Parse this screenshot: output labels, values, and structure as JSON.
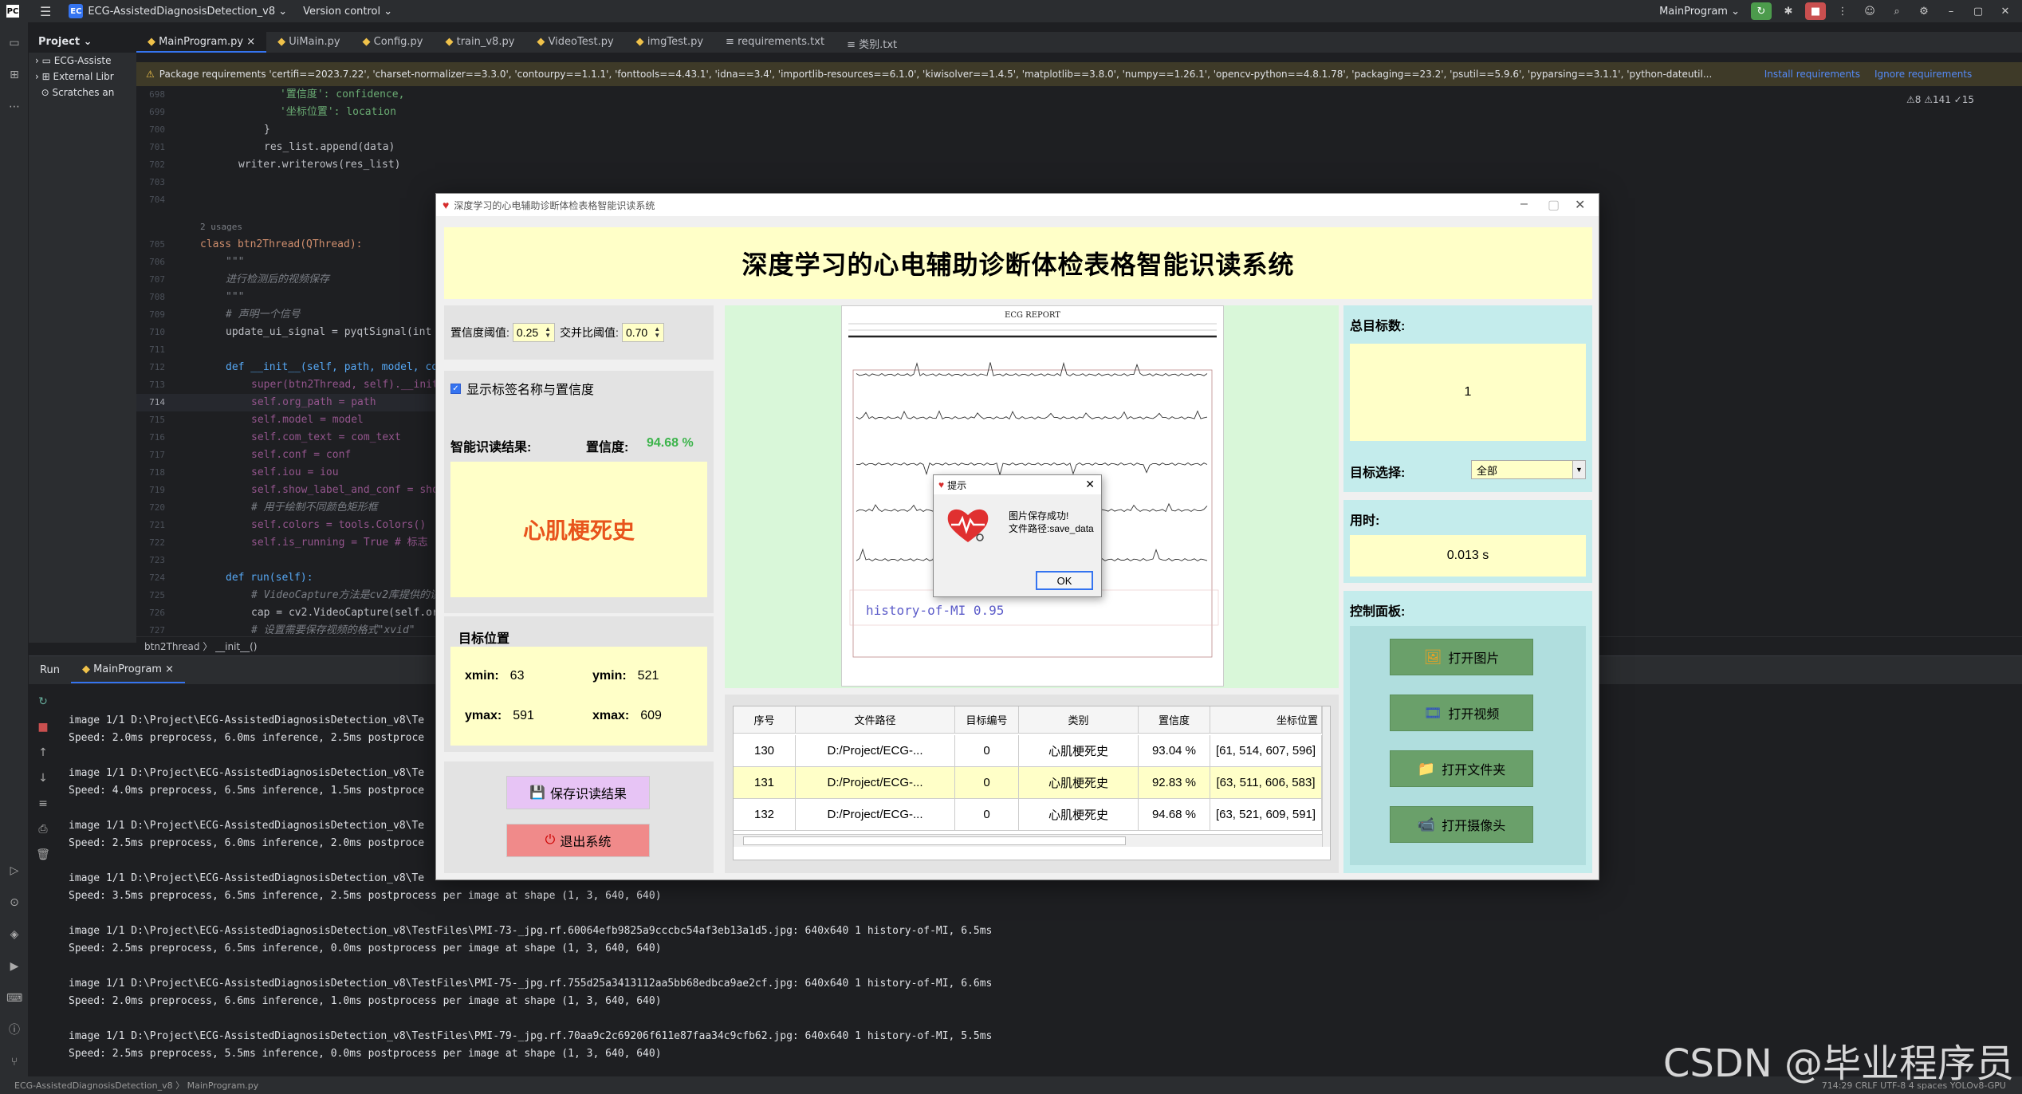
{
  "ide": {
    "badge": "EC",
    "project_name": "ECG-AssistedDiagnosisDetection_v8 ⌄",
    "version_control": "Version control ⌄",
    "run_config": "MainProgram ⌄",
    "project_header": "Project ⌄",
    "tabs": [
      {
        "label": "MainProgram.py ×"
      },
      {
        "label": "UiMain.py"
      },
      {
        "label": "Config.py"
      },
      {
        "label": "train_v8.py"
      },
      {
        "label": "VideoTest.py"
      },
      {
        "label": "imgTest.py"
      },
      {
        "label": "requirements.txt"
      },
      {
        "label": "类别.txt"
      }
    ],
    "tree": [
      "ECG-Assiste",
      "External Libr",
      "Scratches an"
    ],
    "warning": {
      "text": "Package requirements 'certifi==2023.7.22', 'charset-normalizer==3.3.0', 'contourpy==1.1.1', 'fonttools==4.43.1', 'idna==3.4', 'importlib-resources==6.1.0', 'kiwisolver==1.4.5', 'matplotlib==3.8.0', 'numpy==1.26.1', 'opencv-python==4.8.1.78', 'packaging==23.2', 'psutil==5.9.6', 'pyparsing==3.1.1', 'python-dateutil...",
      "install": "Install requirements",
      "ignore": "Ignore requirements"
    },
    "inspection": "⚠8 ⚠141 ✓15",
    "breadcrumb": "btn2Thread  〉 __init__()",
    "run_tab": "Run",
    "run_config_tab": "MainProgram ×",
    "status_left": "ECG-AssistedDiagnosisDetection_v8 〉 MainProgram.py",
    "status_right": "714:29   CRLF   UTF-8   4 spaces   YOLOv8-GPU"
  },
  "code": [
    {
      "ln": "698",
      "text": "'置信度': confidence,"
    },
    {
      "ln": "699",
      "text": "'坐标位置': location"
    },
    {
      "ln": "700",
      "text": "}"
    },
    {
      "ln": "701",
      "text": "res_list.append(data)"
    },
    {
      "ln": "702",
      "text": "writer.writerows(res_list)"
    },
    {
      "ln": "703",
      "text": ""
    },
    {
      "ln": "704",
      "text": ""
    },
    {
      "ln": "",
      "text": "2 usages"
    },
    {
      "ln": "705",
      "text": "class btn2Thread(QThread):"
    },
    {
      "ln": "706",
      "text": "\"\"\""
    },
    {
      "ln": "707",
      "text": "进行检测后的视频保存"
    },
    {
      "ln": "708",
      "text": "\"\"\""
    },
    {
      "ln": "709",
      "text": "# 声明一个信号"
    },
    {
      "ln": "710",
      "text": "update_ui_signal = pyqtSignal(int"
    },
    {
      "ln": "711",
      "text": ""
    },
    {
      "ln": "712",
      "text": "def __init__(self, path, model, co"
    },
    {
      "ln": "713",
      "text": "super(btn2Thread, self).__init"
    },
    {
      "ln": "714",
      "text": "self.org_path = path"
    },
    {
      "ln": "715",
      "text": "self.model = model"
    },
    {
      "ln": "716",
      "text": "self.com_text = com_text"
    },
    {
      "ln": "717",
      "text": "self.conf = conf"
    },
    {
      "ln": "718",
      "text": "self.iou = iou"
    },
    {
      "ln": "719",
      "text": "self.show_label_and_conf = sho"
    },
    {
      "ln": "720",
      "text": "# 用于绘制不同颜色矩形框"
    },
    {
      "ln": "721",
      "text": "self.colors = tools.Colors()"
    },
    {
      "ln": "722",
      "text": "self.is_running = True  # 标志"
    },
    {
      "ln": "723",
      "text": ""
    },
    {
      "ln": "724",
      "text": "def run(self):"
    },
    {
      "ln": "725",
      "text": "# VideoCapture方法是cv2库提供的读"
    },
    {
      "ln": "726",
      "text": "cap = cv2.VideoCapture(self.or"
    },
    {
      "ln": "727",
      "text": "# 设置需要保存视频的格式\"xvid\""
    }
  ],
  "console": [
    "image 1/1 D:\\Project\\ECG-AssistedDiagnosisDetection_v8\\Te",
    "Speed: 2.0ms preprocess, 6.0ms inference, 2.5ms postproce",
    "",
    "image 1/1 D:\\Project\\ECG-AssistedDiagnosisDetection_v8\\Te",
    "Speed: 4.0ms preprocess, 6.5ms inference, 1.5ms postproce",
    "",
    "image 1/1 D:\\Project\\ECG-AssistedDiagnosisDetection_v8\\Te",
    "Speed: 2.5ms preprocess, 6.0ms inference, 2.0ms postproce",
    "",
    "image 1/1 D:\\Project\\ECG-AssistedDiagnosisDetection_v8\\Te",
    "Speed: 3.5ms preprocess, 6.5ms inference, 2.5ms postprocess per image at shape (1, 3, 640, 640)",
    "",
    "image 1/1 D:\\Project\\ECG-AssistedDiagnosisDetection_v8\\TestFiles\\PMI-73-_jpg.rf.60064efb9825a9cccbc54af3eb13a1d5.jpg: 640x640 1 history-of-MI, 6.5ms",
    "Speed: 2.5ms preprocess, 6.5ms inference, 0.0ms postprocess per image at shape (1, 3, 640, 640)",
    "",
    "image 1/1 D:\\Project\\ECG-AssistedDiagnosisDetection_v8\\TestFiles\\PMI-75-_jpg.rf.755d25a3413112aa5bb68edbca9ae2cf.jpg: 640x640 1 history-of-MI, 6.6ms",
    "Speed: 2.0ms preprocess, 6.6ms inference, 1.0ms postprocess per image at shape (1, 3, 640, 640)",
    "",
    "image 1/1 D:\\Project\\ECG-AssistedDiagnosisDetection_v8\\TestFiles\\PMI-79-_jpg.rf.70aa9c2c69206f611e87faa34c9cfb62.jpg: 640x640 1 history-of-MI, 5.5ms",
    "Speed: 2.5ms preprocess, 5.5ms inference, 0.0ms postprocess per image at shape (1, 3, 640, 640)"
  ],
  "watermark": "CSDN @毕业程序员",
  "app": {
    "window_title": "深度学习的心电辅助诊断体检表格智能识读系统",
    "header_title": "深度学习的心电辅助诊断体检表格智能识读系统",
    "conf_threshold_label": "置信度阈值:",
    "conf_threshold": "0.25",
    "iou_threshold_label": "交并比阈值:",
    "iou_threshold": "0.70",
    "show_label_text": "显示标签名称与置信度",
    "result_label": "智能识读结果:",
    "confidence_label": "置信度:",
    "confidence_value": "94.68 %",
    "result_class": "心肌梗死史",
    "position_title": "目标位置",
    "xmin_label": "xmin:",
    "xmin": "63",
    "ymin_label": "ymin:",
    "ymin": "521",
    "ymax_label": "ymax:",
    "ymax": "591",
    "xmax_label": "xmax:",
    "xmax": "609",
    "save_btn": "保存识读结果",
    "exit_btn": "退出系统",
    "detection_label": "history-of-MI  0.95",
    "ecg_report_title": "ECG REPORT",
    "table": {
      "headers": [
        "序号",
        "文件路径",
        "目标编号",
        "类别",
        "置信度",
        "坐标位置"
      ],
      "rows": [
        [
          "130",
          "D:/Project/ECG-...",
          "0",
          "心肌梗死史",
          "93.04 %",
          "[61, 514, 607, 596]"
        ],
        [
          "131",
          "D:/Project/ECG-...",
          "0",
          "心肌梗死史",
          "92.83 %",
          "[63, 511, 606, 583]"
        ],
        [
          "132",
          "D:/Project/ECG-...",
          "0",
          "心肌梗死史",
          "94.68 %",
          "[63, 521, 609, 591]"
        ]
      ]
    },
    "total_label": "总目标数:",
    "total_value": "1",
    "target_select_label": "目标选择:",
    "target_select_value": "全部",
    "time_label": "用时:",
    "time_value": "0.013 s",
    "control_label": "控制面板:",
    "open_image": "打开图片",
    "open_video": "打开视频",
    "open_folder": "打开文件夹",
    "open_camera": "打开摄像头"
  },
  "dialog": {
    "title": "提示",
    "msg1": "图片保存成功!",
    "msg2": "文件路径:save_data",
    "ok": "OK"
  }
}
